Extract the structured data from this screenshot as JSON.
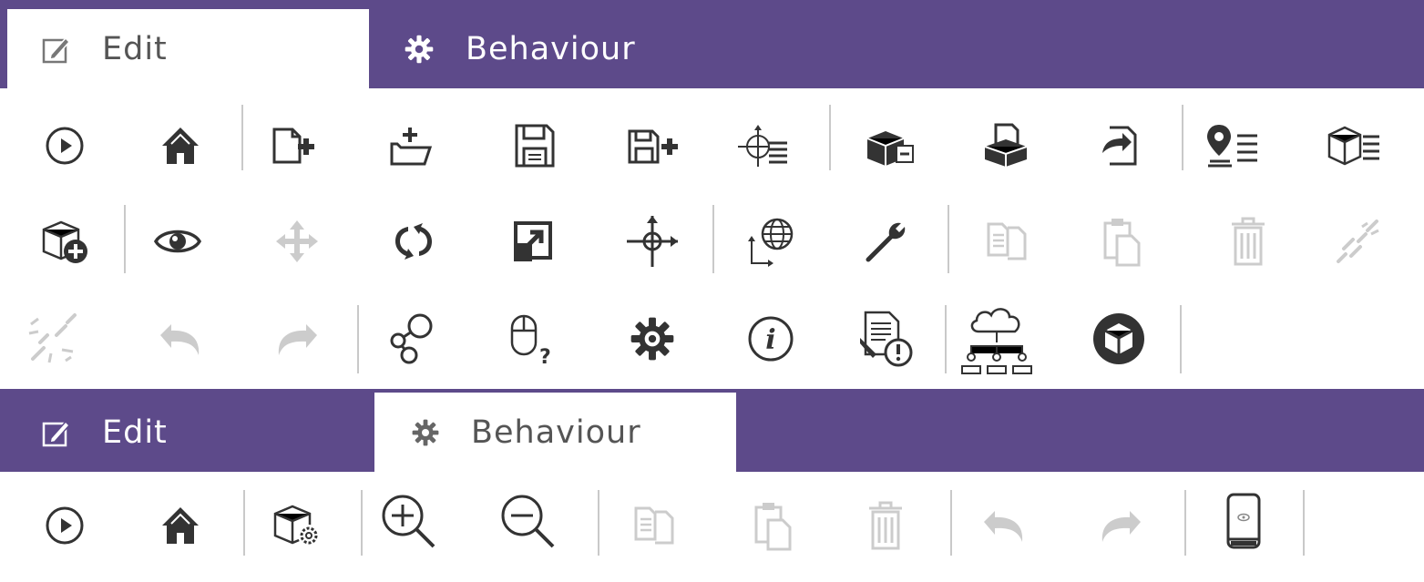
{
  "colors": {
    "accent": "#5d4a8a",
    "icon": "#333333",
    "icon_disabled": "#cccccc"
  },
  "panel_edit": {
    "tabs": [
      {
        "label": "Edit",
        "icon": "edit-icon",
        "active": true
      },
      {
        "label": "Behaviour",
        "icon": "gear-icon",
        "active": false
      }
    ],
    "toolbar": {
      "rows": [
        [
          "play",
          "home",
          "|",
          "new-file",
          "open-folder",
          "save",
          "save-as",
          "|",
          "axis-list",
          "|",
          "remove-package",
          "import-package",
          "export",
          "|",
          "location-list",
          "model-list"
        ],
        [
          "add-model",
          "|",
          "view",
          "move",
          "rotate",
          "scale",
          "transform-axis",
          "|",
          "world-coordinates",
          "wrench",
          "|",
          "copy",
          "paste",
          "delete",
          "link"
        ],
        [
          "unlink",
          "undo",
          "redo",
          "|",
          "share",
          "mouse-help",
          "settings",
          "info",
          "report-warning",
          "|",
          "cloud-hierarchy",
          "cube",
          "|"
        ]
      ],
      "disabled": [
        "move",
        "copy",
        "paste",
        "delete",
        "link",
        "unlink",
        "undo",
        "redo"
      ]
    }
  },
  "panel_behaviour": {
    "tabs": [
      {
        "label": "Edit",
        "icon": "edit-icon",
        "active": false
      },
      {
        "label": "Behaviour",
        "icon": "gear-icon",
        "active": true
      }
    ],
    "toolbar": {
      "rows": [
        [
          "play",
          "home",
          "|",
          "model-settings",
          "|",
          "zoom-in",
          "zoom-out",
          "|",
          "copy",
          "paste",
          "delete",
          "|",
          "undo",
          "redo",
          "|",
          "device",
          "|"
        ]
      ],
      "disabled": [
        "copy",
        "paste",
        "delete",
        "undo",
        "redo"
      ]
    }
  }
}
